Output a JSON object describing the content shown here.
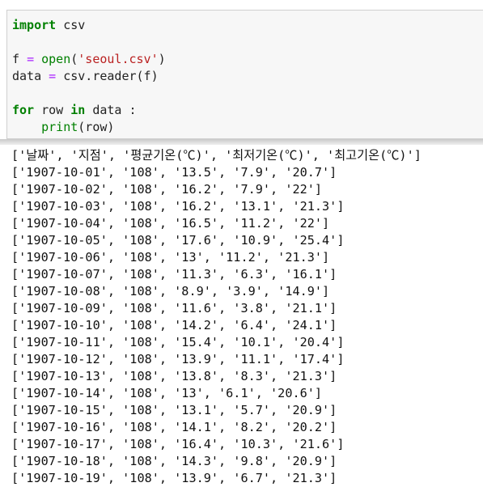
{
  "code_cell": {
    "lines": [
      [
        {
          "t": "import",
          "c": "kw"
        },
        {
          "t": " csv",
          "c": ""
        }
      ],
      [],
      [
        {
          "t": "f ",
          "c": ""
        },
        {
          "t": "=",
          "c": "op"
        },
        {
          "t": " ",
          "c": ""
        },
        {
          "t": "open",
          "c": "bi"
        },
        {
          "t": "(",
          "c": ""
        },
        {
          "t": "'seoul.csv'",
          "c": "str"
        },
        {
          "t": ")",
          "c": ""
        }
      ],
      [
        {
          "t": "data ",
          "c": ""
        },
        {
          "t": "=",
          "c": "op"
        },
        {
          "t": " csv.reader(f)",
          "c": ""
        }
      ],
      [],
      [
        {
          "t": "for",
          "c": "kw"
        },
        {
          "t": " row ",
          "c": ""
        },
        {
          "t": "in",
          "c": "kw"
        },
        {
          "t": " data :",
          "c": ""
        }
      ],
      [
        {
          "t": "    ",
          "c": ""
        },
        {
          "t": "print",
          "c": "bi"
        },
        {
          "t": "(row)",
          "c": ""
        }
      ]
    ]
  },
  "output": {
    "lines": [
      "['날짜', '지점', '평균기온(℃)', '최저기온(℃)', '최고기온(℃)']",
      "['1907-10-01', '108', '13.5', '7.9', '20.7']",
      "['1907-10-02', '108', '16.2', '7.9', '22']",
      "['1907-10-03', '108', '16.2', '13.1', '21.3']",
      "['1907-10-04', '108', '16.5', '11.2', '22']",
      "['1907-10-05', '108', '17.6', '10.9', '25.4']",
      "['1907-10-06', '108', '13', '11.2', '21.3']",
      "['1907-10-07', '108', '11.3', '6.3', '16.1']",
      "['1907-10-08', '108', '8.9', '3.9', '14.9']",
      "['1907-10-09', '108', '11.6', '3.8', '21.1']",
      "['1907-10-10', '108', '14.2', '6.4', '24.1']",
      "['1907-10-11', '108', '15.4', '10.1', '20.4']",
      "['1907-10-12', '108', '13.9', '11.1', '17.4']",
      "['1907-10-13', '108', '13.8', '8.3', '21.3']",
      "['1907-10-14', '108', '13', '6.1', '20.6']",
      "['1907-10-15', '108', '13.1', '5.7', '20.9']",
      "['1907-10-16', '108', '14.1', '8.2', '20.2']",
      "['1907-10-17', '108', '16.4', '10.3', '21.6']",
      "['1907-10-18', '108', '14.3', '9.8', '20.9']",
      "['1907-10-19', '108', '13.9', '6.7', '21.3']"
    ]
  }
}
